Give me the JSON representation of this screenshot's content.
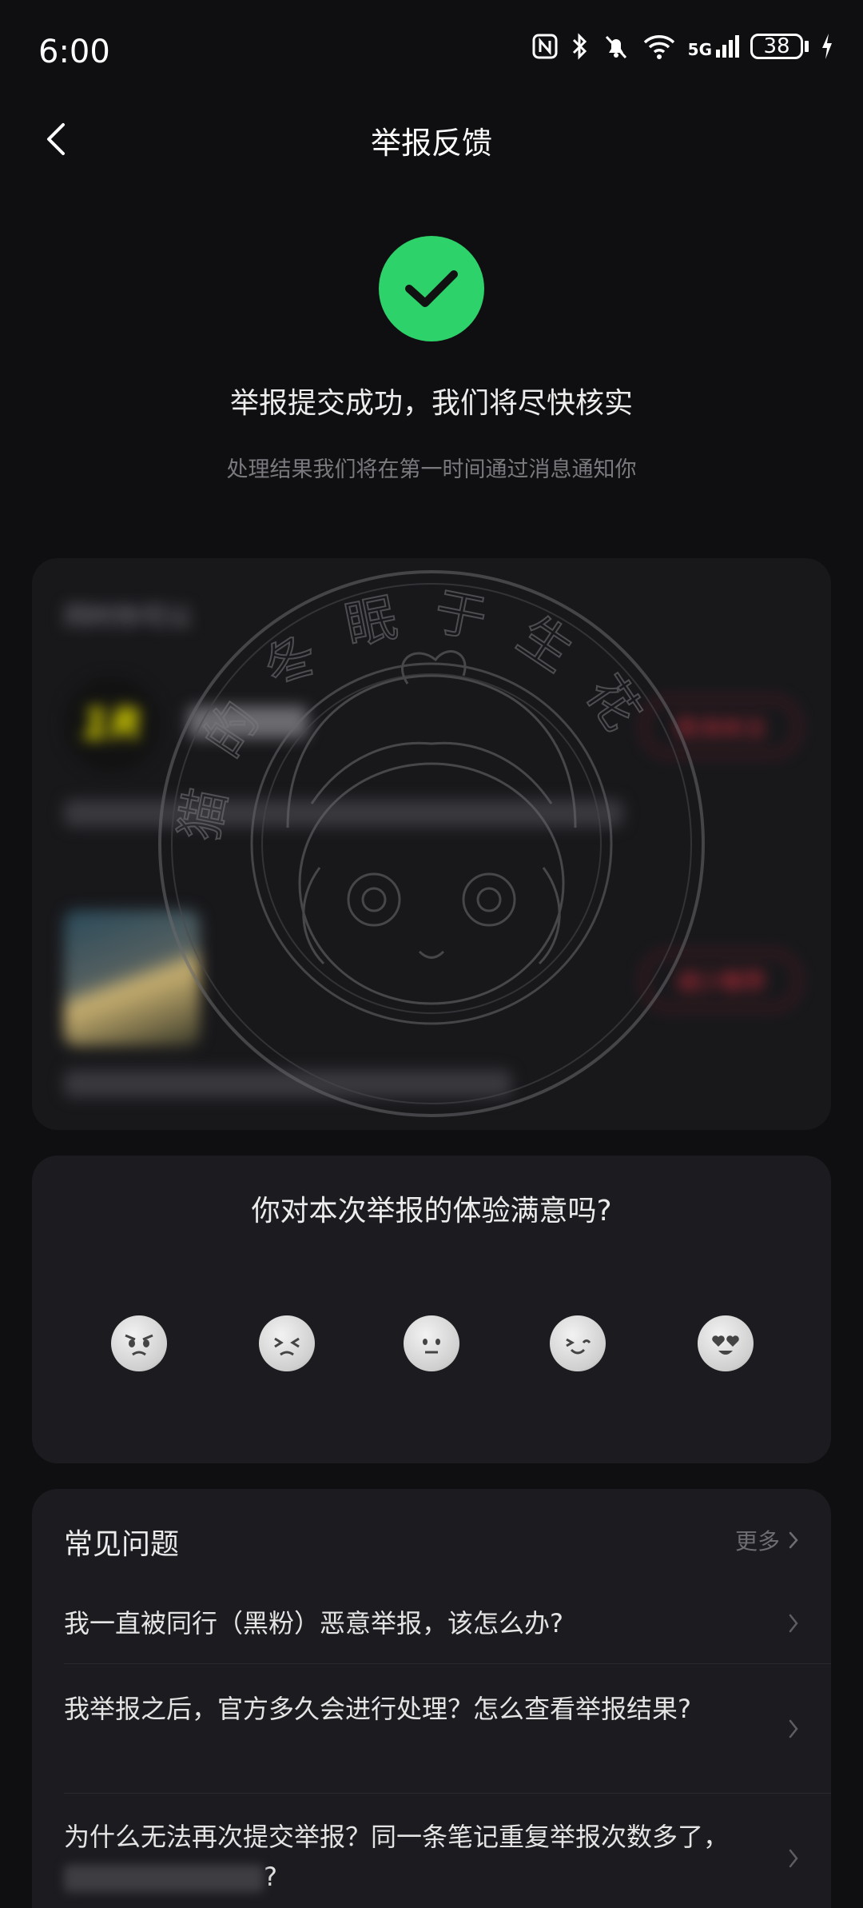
{
  "status_bar": {
    "time": "6:00",
    "network": "5G",
    "battery": "38"
  },
  "header": {
    "title": "举报反馈"
  },
  "success": {
    "title": "举报提交成功，我们将尽快核实",
    "subtitle": "处理结果我们将在第一时间通过消息通知你",
    "icon": "check-icon",
    "color": "#2ed26a"
  },
  "recommendation": {
    "heading": "同时你可以",
    "logo_text": "1R",
    "button_1": "取消关注",
    "button_2": "减少推荐"
  },
  "watermark": {
    "text": "猫的冬眠于生花"
  },
  "satisfaction": {
    "question": "你对本次举报的体验满意吗?",
    "options": [
      "very-dissatisfied",
      "dissatisfied",
      "neutral",
      "satisfied",
      "very-satisfied"
    ]
  },
  "faq": {
    "title": "常见问题",
    "more_label": "更多",
    "items": [
      "我一直被同行（黑粉）恶意举报，该怎么办?",
      "我举报之后，官方多久会进行处理？怎么查看举报结果?",
      "为什么无法再次提交举报？同一条笔记重复举报次数多了，"
    ],
    "item_3_end": "?"
  },
  "colors": {
    "background": "#0f0f11",
    "card": "#1c1c20",
    "accent_green": "#2ed26a",
    "danger_red": "#e03040"
  }
}
